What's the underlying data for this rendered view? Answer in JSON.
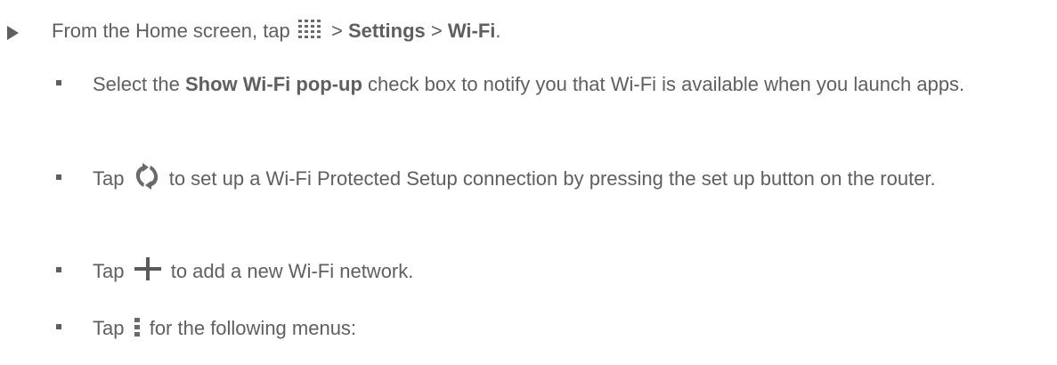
{
  "step": {
    "prefix": "From the Home screen, tap",
    "sep1": " > ",
    "settings": "Settings",
    "sep2": " > ",
    "wifi": "Wi-Fi",
    "end": "."
  },
  "bullets": [
    {
      "pre": "Select the ",
      "bold": "Show Wi-Fi pop-up",
      "post": " check box to notify you that Wi-Fi is available when you launch apps."
    },
    {
      "pre": "Tap ",
      "post": " to set up a Wi-Fi Protected Setup connection by pressing the set up button on the router."
    },
    {
      "pre": "Tap ",
      "post": " to add a new Wi-Fi network."
    },
    {
      "pre": "Tap ",
      "post": " for the following menus:"
    }
  ],
  "icons": {
    "apps": "apps-grid-icon",
    "wps": "wps-icon",
    "plus": "add-icon",
    "menu": "menu-icon"
  },
  "colors": {
    "text": "#5f5f5f",
    "icon": "#6a6a6a"
  }
}
